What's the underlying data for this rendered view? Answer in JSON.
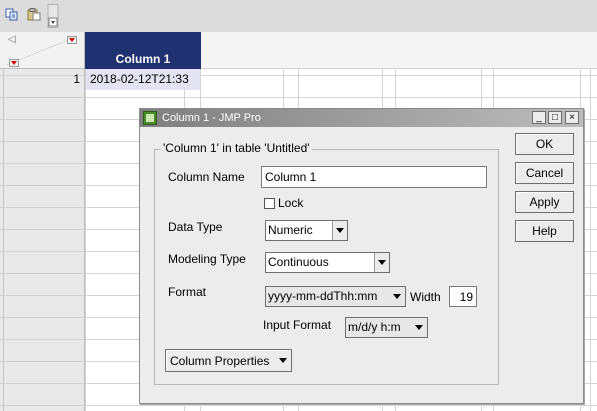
{
  "toolbar": {
    "icons": [
      "copy-icon",
      "paste-icon",
      "small-dropdown-icon"
    ]
  },
  "table": {
    "column_header": "Column 1",
    "rows": [
      {
        "row_number": "1",
        "cell": "2018-02-12T21:33"
      }
    ]
  },
  "dialog": {
    "title": "Column 1 - JMP Pro",
    "window_buttons": {
      "minimize": "_",
      "maximize": "□",
      "close": "×"
    },
    "group_label": "'Column 1' in table 'Untitled'",
    "column_name_label": "Column Name",
    "column_name_value": "Column 1",
    "lock_label": "Lock",
    "lock_checked": false,
    "data_type_label": "Data Type",
    "data_type_value": "Numeric",
    "modeling_type_label": "Modeling Type",
    "modeling_type_value": "Continuous",
    "format_label": "Format",
    "format_value": "yyyy-mm-ddThh:mm",
    "width_label": "Width",
    "width_value": "19",
    "input_format_label": "Input Format",
    "input_format_value": "m/d/y h:m",
    "column_properties_button": "Column Properties",
    "buttons": {
      "ok": "OK",
      "cancel": "Cancel",
      "apply": "Apply",
      "help": "Help"
    }
  },
  "colors": {
    "column_header_bg": "#1f3170",
    "selected_cell_bg": "#e3e3f1",
    "dialog_bg": "#ececec",
    "dropdown_arrow_red": "#d00000"
  }
}
